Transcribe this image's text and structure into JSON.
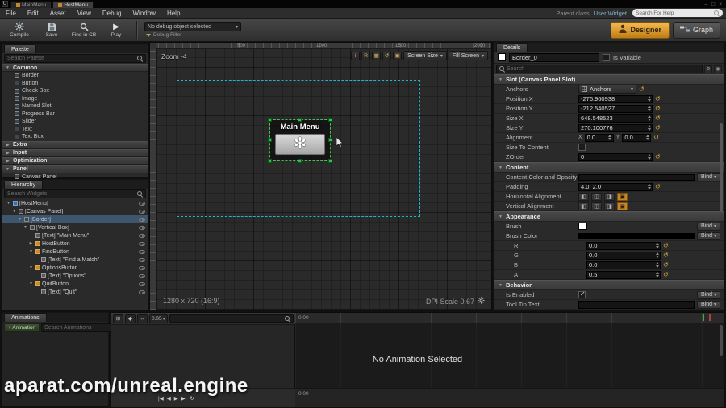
{
  "window": {
    "tabs": [
      {
        "label": "MainMenu",
        "active": false
      },
      {
        "label": "HostMenu",
        "active": true
      }
    ],
    "window_controls": [
      "–",
      "□",
      "×"
    ],
    "menu": [
      "File",
      "Edit",
      "Asset",
      "View",
      "Debug",
      "Window",
      "Help"
    ],
    "parent_class_label": "Parent class:",
    "parent_class_value": "User Widget",
    "help_search_placeholder": "Search For Help"
  },
  "toolbar": {
    "buttons": [
      {
        "label": "Compile",
        "icon": "gear"
      },
      {
        "label": "Save",
        "icon": "save"
      },
      {
        "label": "Find in CB",
        "icon": "find"
      },
      {
        "label": "Play",
        "icon": "play"
      }
    ],
    "debug_object": "No debug object selected",
    "debug_filter": "Debug Filter",
    "designer_label": "Designer",
    "graph_label": "Graph"
  },
  "palette": {
    "tab": "Palette",
    "search_placeholder": "Search Palette",
    "groups": [
      {
        "label": "Common",
        "expanded": true,
        "items": [
          "Border",
          "Button",
          "Check Box",
          "Image",
          "Named Slot",
          "Progress Bar",
          "Slider",
          "Text",
          "Text Box"
        ]
      },
      {
        "label": "Extra",
        "expanded": false,
        "items": []
      },
      {
        "label": "Input",
        "expanded": false,
        "items": []
      },
      {
        "label": "Optimization",
        "expanded": false,
        "items": []
      },
      {
        "label": "Panel",
        "expanded": true,
        "items": [
          "Canvas Panel"
        ]
      }
    ]
  },
  "hierarchy": {
    "tab": "Hierarchy",
    "search_placeholder": "Search Widgets",
    "items": [
      {
        "label": "[HostMenu]",
        "depth": 0,
        "exp": "open",
        "icon": "root",
        "selected": false
      },
      {
        "label": "[Canvas Panel]",
        "depth": 1,
        "exp": "open",
        "icon": "canvas",
        "selected": false
      },
      {
        "label": "[Border]",
        "depth": 2,
        "exp": "open",
        "icon": "border",
        "selected": true
      },
      {
        "label": "[Vertical Box]",
        "depth": 3,
        "exp": "open",
        "icon": "vbox",
        "selected": false
      },
      {
        "label": "[Text] \"Main Menu\"",
        "depth": 4,
        "exp": null,
        "icon": "text",
        "selected": false
      },
      {
        "label": "HostButton",
        "depth": 4,
        "exp": "closed",
        "icon": "button",
        "selected": false
      },
      {
        "label": "FindButton",
        "depth": 4,
        "exp": "open",
        "icon": "button",
        "selected": false
      },
      {
        "label": "[Text] \"Find a Match\"",
        "depth": 5,
        "exp": null,
        "icon": "text",
        "selected": false
      },
      {
        "label": "OptionsButton",
        "depth": 4,
        "exp": "open",
        "icon": "button",
        "selected": false
      },
      {
        "label": "[Text] \"Options\"",
        "depth": 5,
        "exp": null,
        "icon": "text",
        "selected": false
      },
      {
        "label": "QuitButton",
        "depth": 4,
        "exp": "open",
        "icon": "button",
        "selected": false
      },
      {
        "label": "[Text] \"Quit\"",
        "depth": 5,
        "exp": null,
        "icon": "text",
        "selected": false
      }
    ]
  },
  "canvas": {
    "zoom_label": "Zoom -4",
    "mini_buttons": [
      "i",
      "R",
      "▦",
      "↺",
      "▣"
    ],
    "screen_size_label": "Screen Size",
    "fill_screen_label": "Fill Screen",
    "ruler_labels": [
      "500",
      "1000",
      "1500",
      "2000"
    ],
    "widget_text": "Main Menu",
    "resolution_label": "1280 x 720 (16:9)",
    "dpi_label": "DPI Scale 0.67"
  },
  "details": {
    "tab": "Details",
    "object_name": "Border_0",
    "is_variable_label": "Is Variable",
    "search_placeholder": "Search",
    "bind_label": "Bind",
    "rows": [
      {
        "type": "section",
        "label": "Slot (Canvas Panel Slot)"
      },
      {
        "type": "dropdown",
        "label": "Anchors",
        "value": "Anchors"
      },
      {
        "type": "number",
        "label": "Position X",
        "value": "-276.960938"
      },
      {
        "type": "number",
        "label": "Position Y",
        "value": "-212.540527"
      },
      {
        "type": "number",
        "label": "Size X",
        "value": "648.548523"
      },
      {
        "type": "number",
        "label": "Size Y",
        "value": "270.100776"
      },
      {
        "type": "xy",
        "label": "Alignment",
        "x_label": "X",
        "x": "0.0",
        "y_label": "Y",
        "y": "0.0"
      },
      {
        "type": "check",
        "label": "Size To Content",
        "checked": false
      },
      {
        "type": "number",
        "label": "ZOrder",
        "value": "0"
      },
      {
        "type": "section",
        "label": "Content"
      },
      {
        "type": "colorbind",
        "label": "Content Color and Opacity",
        "bar_color": "#151515"
      },
      {
        "type": "text",
        "label": "Padding",
        "value": "4.0, 2.0"
      },
      {
        "type": "align",
        "label": "Horizontal Alignment",
        "selected": 3
      },
      {
        "type": "align",
        "label": "Vertical Alignment",
        "selected": 3
      },
      {
        "type": "section",
        "label": "Appearance"
      },
      {
        "type": "brush",
        "label": "Brush",
        "swatch": "#ffffff"
      },
      {
        "type": "colorbind",
        "label": "Brush Color",
        "bar_color": "#000000"
      },
      {
        "type": "number",
        "label": "R",
        "value": "0.0",
        "indent": 1
      },
      {
        "type": "number",
        "label": "G",
        "value": "0.0",
        "indent": 1
      },
      {
        "type": "number",
        "label": "B",
        "value": "0.0",
        "indent": 1
      },
      {
        "type": "number",
        "label": "A",
        "value": "0.5",
        "indent": 1
      },
      {
        "type": "section",
        "label": "Behavior"
      },
      {
        "type": "checkbind",
        "label": "Is Enabled",
        "checked": true
      },
      {
        "type": "textbind",
        "label": "Tool Tip Text",
        "value": ""
      }
    ]
  },
  "animations": {
    "tab": "Animations",
    "add_label": "+ Animation",
    "search_placeholder": "Search Animations",
    "toolbar_icons": [
      "⊞",
      "◆",
      "↔"
    ],
    "snap_value": "0.05",
    "time_start": "0.00",
    "no_selection": "No Animation Selected",
    "playback_icons": [
      "|◀",
      "◀",
      "▶",
      "▶|",
      "↻"
    ]
  },
  "watermark": "aparat.com/unreal.engine"
}
